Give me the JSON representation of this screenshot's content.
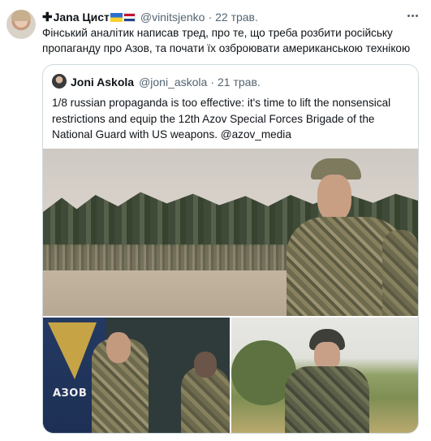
{
  "tweet": {
    "author": {
      "cross": "✚",
      "name": "Jana Цист",
      "flags": [
        "ua-flag",
        "nl-flag"
      ],
      "handle": "@vinitsjenko",
      "separator": "·",
      "time": "22 трав."
    },
    "text": "Фінський аналітик написав тред, про те, що треба розбити російську пропаганду про Азов, та почати їх озброювати американською технікою",
    "more_icon": "more-dots-icon"
  },
  "quote": {
    "author": {
      "name": "Joni Askola",
      "handle": "@joni_askola",
      "separator": "·",
      "time": "21 трав."
    },
    "text": "1/8 russian propaganda is too effective: it's time to lift the nonsensical restrictions and equip the 12th Azov Special Forces Brigade of the National Guard with US weapons. @azov_media",
    "media": {
      "banner_text": "АЗОВ",
      "photos": [
        "formation-photo",
        "portrait-photo",
        "field-soldier-photo"
      ]
    }
  },
  "colors": {
    "text": "#0f1419",
    "secondary": "#536471",
    "border": "#cfd9de"
  }
}
